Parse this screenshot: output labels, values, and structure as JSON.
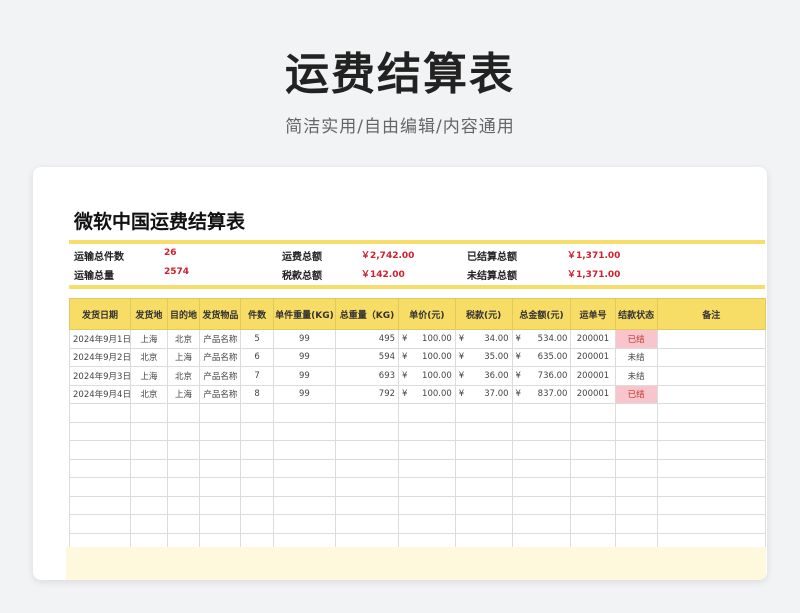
{
  "hero": {
    "title": "运费结算表",
    "subtitle": "简洁实用/自由编辑/内容通用"
  },
  "sheet": {
    "title": "微软中国运费结算表",
    "summary": {
      "total_items_label": "运输总件数",
      "total_items_value": "26",
      "total_weight_label": "运输总量",
      "total_weight_value": "2574",
      "freight_total_label": "运费总额",
      "freight_total_value": "￥2,742.00",
      "tax_total_label": "税款总额",
      "tax_total_value": "￥142.00",
      "settled_label": "已结算总额",
      "settled_value": "￥1,371.00",
      "unsettled_label": "未结算总额",
      "unsettled_value": "￥1,371.00"
    },
    "columns": [
      "发货日期",
      "发货地",
      "目的地",
      "发货物品",
      "件数",
      "单件重量(KG)",
      "总重量（KG)",
      "单价(元)",
      "税款(元)",
      "总金额(元)",
      "运单号",
      "结款状态",
      "备注"
    ],
    "currency": "¥",
    "rows": [
      {
        "date": "2024年9月1日",
        "from": "上海",
        "to": "北京",
        "item": "产品名称",
        "qty": "5",
        "unit_w": "99",
        "total_w": "495",
        "price": "100.00",
        "tax": "34.00",
        "amount": "534.00",
        "waybill": "200001",
        "status": "已结",
        "status_type": "done",
        "note": ""
      },
      {
        "date": "2024年9月2日",
        "from": "北京",
        "to": "上海",
        "item": "产品名称",
        "qty": "6",
        "unit_w": "99",
        "total_w": "594",
        "price": "100.00",
        "tax": "35.00",
        "amount": "635.00",
        "waybill": "200001",
        "status": "未结",
        "status_type": "open",
        "note": ""
      },
      {
        "date": "2024年9月3日",
        "from": "上海",
        "to": "北京",
        "item": "产品名称",
        "qty": "7",
        "unit_w": "99",
        "total_w": "693",
        "price": "100.00",
        "tax": "36.00",
        "amount": "736.00",
        "waybill": "200001",
        "status": "未结",
        "status_type": "open",
        "note": ""
      },
      {
        "date": "2024年9月4日",
        "from": "北京",
        "to": "上海",
        "item": "产品名称",
        "qty": "8",
        "unit_w": "99",
        "total_w": "792",
        "price": "100.00",
        "tax": "37.00",
        "amount": "837.00",
        "waybill": "200001",
        "status": "已结",
        "status_type": "done",
        "note": ""
      }
    ],
    "empty_rows": 8,
    "colors": {
      "header_yellow": "#f7dc66",
      "accent_red": "#d0202b",
      "status_done_bg": "#f8c5cc"
    }
  }
}
